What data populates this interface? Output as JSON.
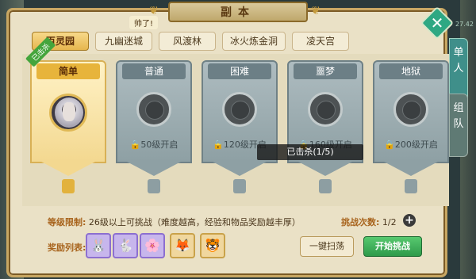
{
  "window": {
    "title": "副本",
    "speech": "帅了!"
  },
  "side_tabs": [
    {
      "label": "单人"
    },
    {
      "label": "组队"
    }
  ],
  "top_stat": "27.42",
  "dungeon_tabs": [
    {
      "label": "百灵园",
      "active": true
    },
    {
      "label": "九幽迷城",
      "active": false
    },
    {
      "label": "风渡林",
      "active": false
    },
    {
      "label": "冰火炼金洞",
      "active": false
    },
    {
      "label": "凌天宫",
      "active": false
    }
  ],
  "difficulties": [
    {
      "name": "简单",
      "unlock": "",
      "ribbon": "已击杀",
      "icon": "boss-portrait"
    },
    {
      "name": "普通",
      "unlock": "50级开启",
      "icon": "lock-icon"
    },
    {
      "name": "困难",
      "unlock": "120级开启",
      "icon": "lock-icon"
    },
    {
      "name": "噩梦",
      "unlock": "160级开启",
      "icon": "lock-icon"
    },
    {
      "name": "地狱",
      "unlock": "200级开启",
      "icon": "lock-icon"
    }
  ],
  "tooltip": "已击杀(1/5)",
  "level_limit": {
    "label": "等级限制:",
    "value": "26级以上可挑战（难度越高，经验和物品奖励越丰厚）"
  },
  "challenge_count": {
    "label": "挑战次数:",
    "value": "1/2"
  },
  "rewards": {
    "label": "奖励列表:",
    "items": [
      {
        "icon": "purple-creature-icon",
        "glyph": "🐰"
      },
      {
        "icon": "gold-creature-icon",
        "glyph": "🐇"
      },
      {
        "icon": "flower-spirit-icon",
        "glyph": "🌸"
      },
      {
        "icon": "fox-pet-icon",
        "glyph": "🦊"
      },
      {
        "icon": "tiger-pet-icon",
        "glyph": "🐯"
      }
    ]
  },
  "buttons": {
    "sweep": "一键扫荡",
    "start": "开始挑战"
  },
  "colors": {
    "accent": "#e7b43b",
    "start": "#2f9a4a",
    "tab_active": "#3f8f8a"
  }
}
